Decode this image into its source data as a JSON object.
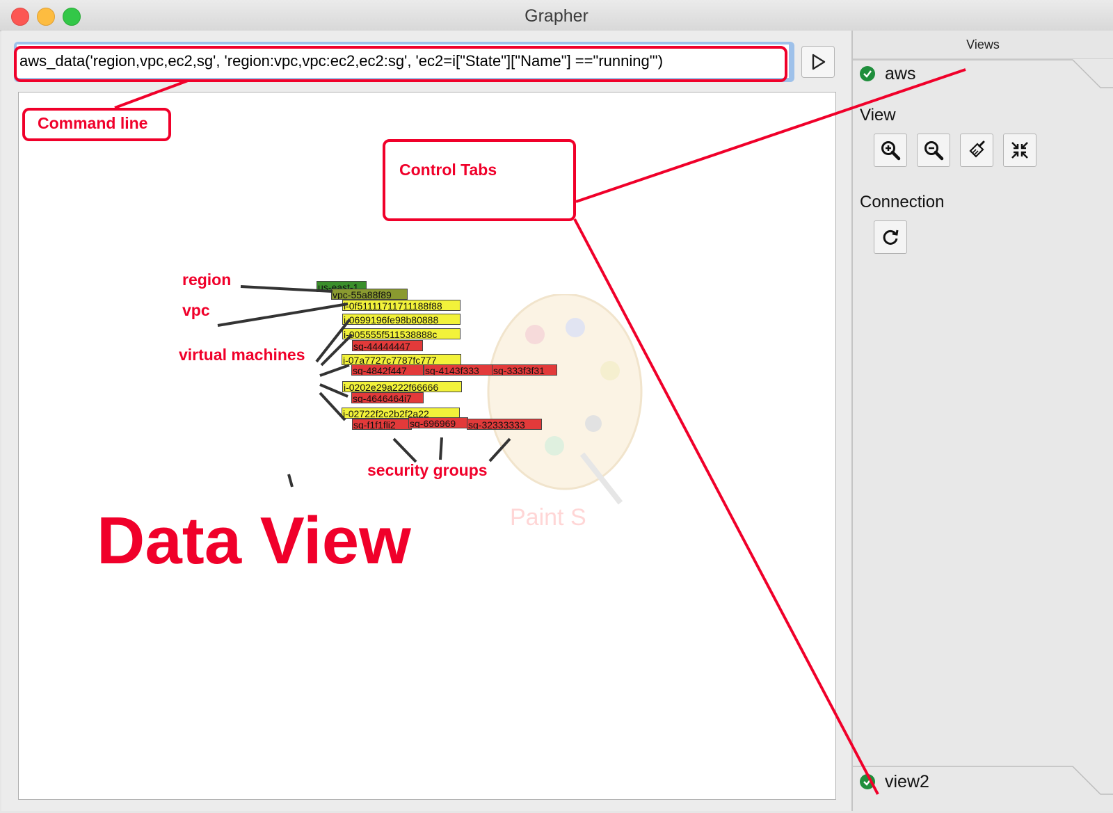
{
  "window": {
    "title": "Grapher"
  },
  "command": {
    "value": "aws_data('region,vpc,ec2,sg', 'region:vpc,vpc:ec2,ec2:sg', 'ec2=i[\"State\"][\"Name\"] ==\"running\"')"
  },
  "sidebar": {
    "header": "Views",
    "tabs": [
      {
        "label": "aws"
      },
      {
        "label": "view2"
      }
    ],
    "view_label": "View",
    "connection_label": "Connection",
    "view_tools": [
      "zoom-in-icon",
      "zoom-out-icon",
      "brush-icon",
      "fit-to-view-icon"
    ],
    "connection_tools": [
      "refresh-icon"
    ]
  },
  "graph": {
    "region": "us-east-1",
    "vpc": "vpc-55a88f89",
    "instances": [
      "i-0f51111711711188f88",
      "i-0699196fe98b80888",
      "i-005555f511538888c",
      "i-07a7727c7787fc777",
      "i-0202e29a222f66666",
      "i-02722f2c2b2f2a22"
    ],
    "security_groups": [
      "sg-44444447",
      "sg-4842f447",
      "sg-4143f333",
      "sg-333f3f31",
      "sg-4646464i7",
      "sg-f1f1fli2",
      "sg-696969",
      "sg-32333333"
    ]
  },
  "annotations": {
    "command_line": "Command line",
    "control_tabs": "Control Tabs",
    "region": "region",
    "vpc": "vpc",
    "virtual_machines": "virtual machines",
    "security_groups": "security groups",
    "data_view": "Data View"
  },
  "watermark": "Paint S",
  "colors": {
    "annotation": "#f0002a",
    "region_node": "#3a8f2b",
    "vpc_node": "#8a9a30",
    "ec2_node": "#f2f23a",
    "sg_node": "#e23a3a",
    "status_check": "#1f8e3c"
  }
}
